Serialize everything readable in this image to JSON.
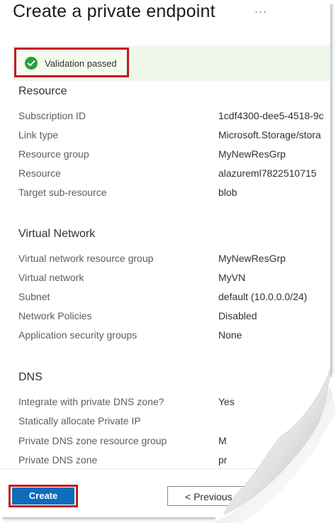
{
  "header": {
    "title": "Create a private endpoint",
    "more_icon": "more-icon",
    "more_glyph": "···"
  },
  "validation": {
    "text": "Validation passed",
    "icon": "check-circle-icon",
    "color": "#2e9e3c"
  },
  "sections": {
    "resource": {
      "title": "Resource",
      "rows": [
        {
          "label": "Subscription ID",
          "value": "1cdf4300-dee5-4518-9c"
        },
        {
          "label": "Link type",
          "value": "Microsoft.Storage/stora"
        },
        {
          "label": "Resource group",
          "value": "MyNewResGrp"
        },
        {
          "label": "Resource",
          "value": "alazureml7822510715"
        },
        {
          "label": "Target sub-resource",
          "value": "blob"
        }
      ]
    },
    "network": {
      "title": "Virtual Network",
      "rows": [
        {
          "label": "Virtual network resource group",
          "value": "MyNewResGrp"
        },
        {
          "label": "Virtual network",
          "value": "MyVN"
        },
        {
          "label": "Subnet",
          "value": "default (10.0.0.0/24)"
        },
        {
          "label": "Network Policies",
          "value": "Disabled"
        },
        {
          "label": "Application security groups",
          "value": "None"
        }
      ]
    },
    "dns": {
      "title": "DNS",
      "rows": [
        {
          "label": "Integrate with private DNS zone?",
          "value": "Yes"
        },
        {
          "label": "Statically allocate Private IP",
          "value": ""
        },
        {
          "label": "Private DNS zone resource group",
          "value": "M"
        },
        {
          "label": "Private DNS zone",
          "value": "pr"
        }
      ]
    }
  },
  "footer": {
    "create_label": "Create",
    "previous_label": "< Previous"
  },
  "colors": {
    "accent": "#0f6cbd",
    "highlight_border": "#c4191c",
    "validation_bg": "#eff7ea"
  }
}
